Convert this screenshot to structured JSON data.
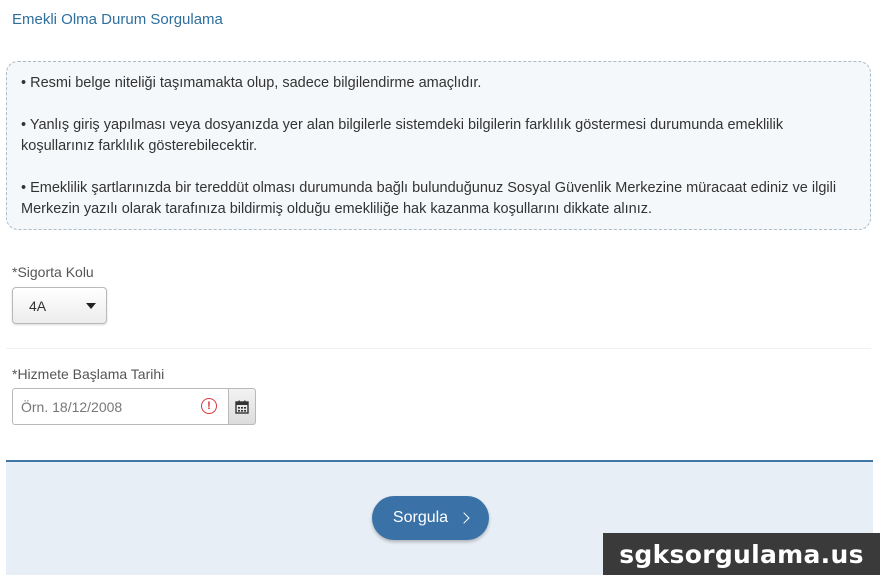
{
  "page": {
    "title": "Emekli Olma Durum Sorgulama"
  },
  "info": {
    "items": [
      "• Resmi belge niteliği taşımamakta olup, sadece bilgilendirme amaçlıdır.",
      "• Yanlış giriş yapılması veya dosyanızda yer alan bilgilerle sistemdeki bilgilerin farklılık göstermesi durumunda emeklilik koşullarınız farklılık gösterebilecektir.",
      "• Emeklilik şartlarınızda bir tereddüt olması durumunda bağlı bulunduğunuz Sosyal Güvenlik Merkezine müracaat ediniz ve ilgili Merkezin yazılı olarak tarafınıza bildirmiş olduğu emekliliğe hak kazanma koşullarını dikkate alınız."
    ]
  },
  "form": {
    "sigorta_label": "*Sigorta Kolu",
    "sigorta_value": "4A",
    "tarih_label": "*Hizmete Başlama Tarihi",
    "tarih_placeholder": "Örn. 18/12/2008",
    "tarih_value": "",
    "warning_glyph": "!"
  },
  "actions": {
    "submit_label": "Sorgula"
  },
  "watermark": {
    "text": "sgksorgulama.us"
  },
  "icons": {
    "select_caret": "caret-down-icon",
    "warning": "warning-circle-icon",
    "calendar": "calendar-icon",
    "submit_arrow": "chevron-right-icon"
  },
  "colors": {
    "title": "#2e6f9e",
    "primary_button": "#3a72a8",
    "footer_bg": "#e7eef5",
    "footer_border": "#3f78a6",
    "warning": "#d9363e"
  }
}
